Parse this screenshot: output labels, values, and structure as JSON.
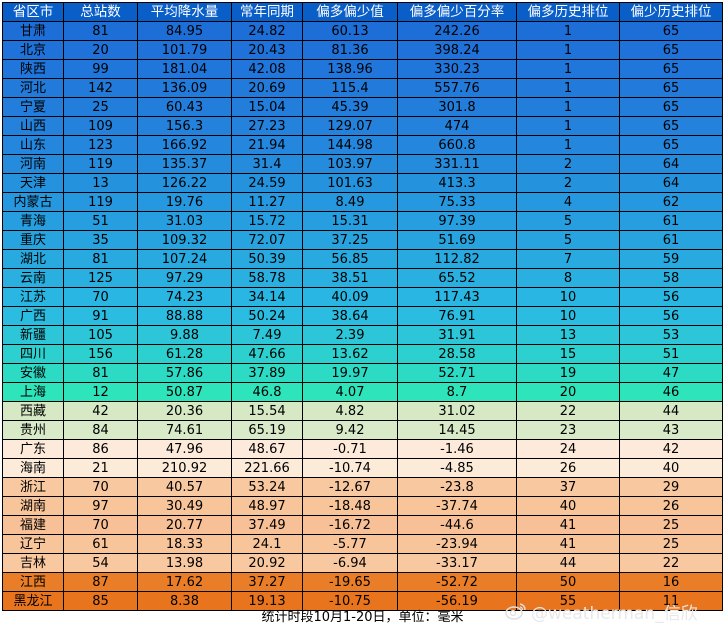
{
  "table": {
    "columns": [
      "省区市",
      "总站数",
      "平均降水量",
      "常年同期",
      "偏多偏少值",
      "偏多偏少百分率",
      "偏多历史排位",
      "偏少历史排位"
    ],
    "rows": [
      {
        "cells": [
          "甘肃",
          "81",
          "84.95",
          "24.82",
          "60.13",
          "242.26",
          "1",
          "65"
        ],
        "bg": "#1e6ed8"
      },
      {
        "cells": [
          "北京",
          "20",
          "101.79",
          "20.43",
          "81.36",
          "398.24",
          "1",
          "65"
        ],
        "bg": "#1f72d9"
      },
      {
        "cells": [
          "陕西",
          "99",
          "181.04",
          "42.08",
          "138.96",
          "330.23",
          "1",
          "65"
        ],
        "bg": "#2076da"
      },
      {
        "cells": [
          "河北",
          "142",
          "136.09",
          "20.69",
          "115.4",
          "557.76",
          "1",
          "65"
        ],
        "bg": "#227ada"
      },
      {
        "cells": [
          "宁夏",
          "25",
          "60.43",
          "15.04",
          "45.39",
          "301.8",
          "1",
          "65"
        ],
        "bg": "#237edb"
      },
      {
        "cells": [
          "山西",
          "109",
          "156.3",
          "27.23",
          "129.07",
          "474",
          "1",
          "65"
        ],
        "bg": "#2482dc"
      },
      {
        "cells": [
          "山东",
          "123",
          "166.92",
          "21.94",
          "144.98",
          "660.8",
          "1",
          "65"
        ],
        "bg": "#2586dd"
      },
      {
        "cells": [
          "河南",
          "119",
          "135.37",
          "31.4",
          "103.97",
          "331.11",
          "2",
          "64"
        ],
        "bg": "#258cdd"
      },
      {
        "cells": [
          "天津",
          "13",
          "126.22",
          "24.59",
          "101.63",
          "413.3",
          "2",
          "64"
        ],
        "bg": "#2592de"
      },
      {
        "cells": [
          "内蒙古",
          "119",
          "19.76",
          "11.27",
          "8.49",
          "75.33",
          "4",
          "62"
        ],
        "bg": "#2698df"
      },
      {
        "cells": [
          "青海",
          "51",
          "31.03",
          "15.72",
          "15.31",
          "97.39",
          "5",
          "61"
        ],
        "bg": "#269ee0"
      },
      {
        "cells": [
          "重庆",
          "35",
          "109.32",
          "72.07",
          "37.25",
          "51.69",
          "5",
          "61"
        ],
        "bg": "#27a4e0"
      },
      {
        "cells": [
          "湖北",
          "81",
          "107.24",
          "50.39",
          "56.85",
          "112.82",
          "7",
          "59"
        ],
        "bg": "#28aae1"
      },
      {
        "cells": [
          "云南",
          "125",
          "97.29",
          "58.78",
          "38.51",
          "65.52",
          "8",
          "58"
        ],
        "bg": "#29b0e1"
      },
      {
        "cells": [
          "江苏",
          "70",
          "74.23",
          "34.14",
          "40.09",
          "117.43",
          "10",
          "56"
        ],
        "bg": "#2ab6e2"
      },
      {
        "cells": [
          "广西",
          "91",
          "88.88",
          "50.24",
          "38.64",
          "76.91",
          "10",
          "56"
        ],
        "bg": "#2bbce2"
      },
      {
        "cells": [
          "新疆",
          "105",
          "9.88",
          "7.49",
          "2.39",
          "31.91",
          "13",
          "53"
        ],
        "bg": "#2cc6d8"
      },
      {
        "cells": [
          "四川",
          "156",
          "61.28",
          "47.66",
          "13.62",
          "28.58",
          "15",
          "51"
        ],
        "bg": "#2cd0ce"
      },
      {
        "cells": [
          "安徽",
          "81",
          "57.86",
          "37.89",
          "19.97",
          "52.71",
          "19",
          "47"
        ],
        "bg": "#2ddac4"
      },
      {
        "cells": [
          "上海",
          "12",
          "50.87",
          "46.8",
          "4.07",
          "8.7",
          "20",
          "46"
        ],
        "bg": "#2ee4ba"
      },
      {
        "cells": [
          "西藏",
          "42",
          "20.36",
          "15.54",
          "4.82",
          "31.02",
          "22",
          "44"
        ],
        "bg": "#d6e8c4"
      },
      {
        "cells": [
          "贵州",
          "84",
          "74.61",
          "65.19",
          "9.42",
          "14.45",
          "23",
          "43"
        ],
        "bg": "#d8eac8"
      },
      {
        "cells": [
          "广东",
          "86",
          "47.96",
          "48.67",
          "-0.71",
          "-1.46",
          "24",
          "42"
        ],
        "bg": "#fdeada"
      },
      {
        "cells": [
          "海南",
          "21",
          "210.92",
          "221.66",
          "-10.74",
          "-4.85",
          "26",
          "40"
        ],
        "bg": "#fdebd9"
      },
      {
        "cells": [
          "浙江",
          "70",
          "40.57",
          "53.24",
          "-12.67",
          "-23.8",
          "37",
          "29"
        ],
        "bg": "#f8c8a0"
      },
      {
        "cells": [
          "湖南",
          "97",
          "30.49",
          "48.97",
          "-18.48",
          "-37.74",
          "40",
          "26"
        ],
        "bg": "#f8c49a"
      },
      {
        "cells": [
          "福建",
          "70",
          "20.77",
          "37.49",
          "-16.72",
          "-44.6",
          "41",
          "25"
        ],
        "bg": "#f8c096"
      },
      {
        "cells": [
          "辽宁",
          "61",
          "18.33",
          "24.1",
          "-5.77",
          "-23.94",
          "41",
          "25"
        ],
        "bg": "#f8c49a"
      },
      {
        "cells": [
          "吉林",
          "54",
          "13.98",
          "20.92",
          "-6.94",
          "-33.17",
          "44",
          "22"
        ],
        "bg": "#f8c8a0"
      },
      {
        "cells": [
          "江西",
          "87",
          "17.62",
          "37.27",
          "-19.65",
          "-52.72",
          "50",
          "16"
        ],
        "bg": "#ea7e28"
      },
      {
        "cells": [
          "黑龙江",
          "85",
          "8.38",
          "19.13",
          "-10.75",
          "-56.19",
          "55",
          "11"
        ],
        "bg": "#e8741e"
      }
    ]
  },
  "footer": "统计时段10月1-20日，单位：毫米",
  "watermark": "@weatherman_信欣",
  "colors": {
    "header_bg": "#0a5ec8",
    "header_text": "#ffffff",
    "border": "#000000"
  }
}
